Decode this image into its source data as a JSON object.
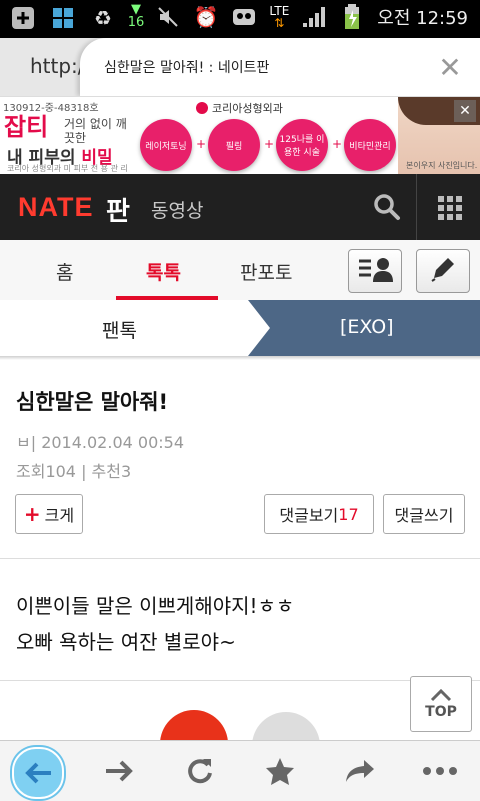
{
  "status_bar": {
    "notification_count": "16",
    "network": "LTE",
    "time": "오전 12:59"
  },
  "browser": {
    "url_partial": "http:/",
    "page_tab_title": "심한말은 말아줘! : 네이트판",
    "close_label": "✕"
  },
  "ad": {
    "code": "130912-중-48318호",
    "headline": "잡티",
    "subtext": "거의 없이 깨끗한",
    "big_text_prefix": "내 피부의 ",
    "big_text_highlight": "비밀은?",
    "tiny_text": "코리아 성형외과 미 피부 전 용 관 리",
    "brand": "코리아성형외과",
    "circles": [
      "레이저토닝",
      "필링",
      "125나를 이용한 시술",
      "비타민관리"
    ],
    "face_caption": "본이우지 사진입니다."
  },
  "nate": {
    "logo": "NATE",
    "pan": "판",
    "video": "동영상"
  },
  "tabs": {
    "home": "홈",
    "toktok": "톡톡",
    "panphoto": "판포토"
  },
  "breadcrumb": {
    "left": "팬톡",
    "right": "[EXO]"
  },
  "post": {
    "title": "심한말은 말아줘!",
    "author_date": "ㅂ| 2014.02.04 00:54",
    "stats": "조회104 | 추천3",
    "enlarge_label": "크게",
    "view_comments_label": "댓글보기",
    "comment_count": "17",
    "write_comment_label": "댓글쓰기",
    "body_lines": [
      "이쁜이들 말은 이쁘게해야지!ㅎㅎ",
      "오빠 욕하는 여잔 별로야~"
    ]
  },
  "top_button": "TOP",
  "colors": {
    "accent": "#e30b2a",
    "breadcrumb_active": "#4d6786",
    "nate_bar": "#202020"
  }
}
